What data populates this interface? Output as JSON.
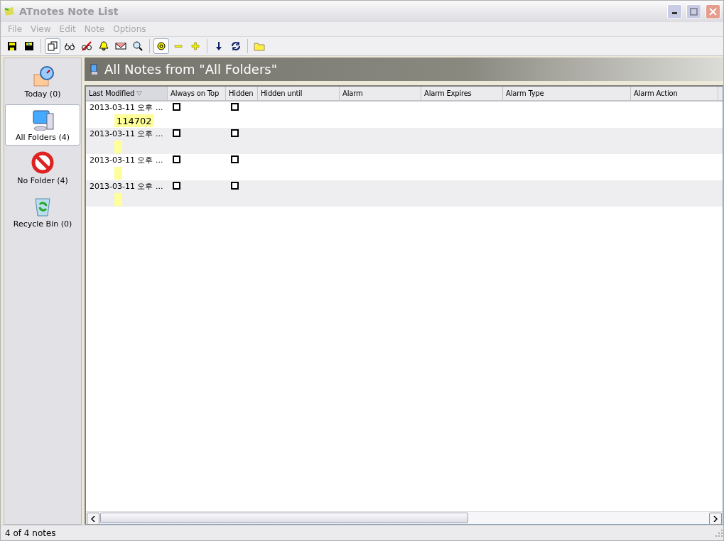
{
  "window": {
    "title": "ATnotes Note List"
  },
  "menu": [
    {
      "label": "File"
    },
    {
      "label": "View"
    },
    {
      "label": "Edit"
    },
    {
      "label": "Note"
    },
    {
      "label": "Options"
    }
  ],
  "toolbar": [
    [
      {
        "kind": "save",
        "pressed": false
      },
      {
        "kind": "saveas",
        "pressed": false
      }
    ],
    [
      {
        "kind": "copy",
        "pressed": true
      },
      {
        "kind": "glasses",
        "pressed": false
      },
      {
        "kind": "noglasses",
        "pressed": false
      },
      {
        "kind": "bell",
        "pressed": false
      },
      {
        "kind": "envelope",
        "pressed": false
      },
      {
        "kind": "search",
        "pressed": false
      }
    ],
    [
      {
        "kind": "target",
        "pressed": true
      },
      {
        "kind": "minus",
        "pressed": false
      },
      {
        "kind": "plus",
        "pressed": false
      }
    ],
    [
      {
        "kind": "down",
        "pressed": false
      },
      {
        "kind": "refresh",
        "pressed": false
      }
    ],
    [
      {
        "kind": "folder",
        "pressed": false
      }
    ]
  ],
  "sidebar": {
    "items": [
      {
        "kind": "today",
        "label": "Today (0)",
        "selected": false
      },
      {
        "kind": "computer",
        "label": "All Folders (4)",
        "selected": true
      },
      {
        "kind": "nofolder",
        "label": "No Folder (4)",
        "selected": false
      },
      {
        "kind": "recycle",
        "label": "Recycle Bin (0)",
        "selected": false
      }
    ]
  },
  "header": {
    "title": "All Notes from \"All Folders\""
  },
  "table": {
    "columns": [
      {
        "label": "Last Modified",
        "sorted": true
      },
      {
        "label": "Always on Top",
        "sorted": false
      },
      {
        "label": "Hidden",
        "sorted": false
      },
      {
        "label": "Hidden until",
        "sorted": false
      },
      {
        "label": "Alarm",
        "sorted": false
      },
      {
        "label": "Alarm Expires",
        "sorted": false
      },
      {
        "label": "Alarm Type",
        "sorted": false
      },
      {
        "label": "Alarm Action",
        "sorted": false
      }
    ],
    "rows": [
      {
        "modified": "2013-03-11 오후 ...",
        "always_on_top": false,
        "hidden": false,
        "note": "114702",
        "color": "#ffff99"
      },
      {
        "modified": "2013-03-11 오후 ...",
        "always_on_top": false,
        "hidden": false,
        "color": "#ffff99"
      },
      {
        "modified": "2013-03-11 오후 ...",
        "always_on_top": false,
        "hidden": false,
        "color": "#ffff99"
      },
      {
        "modified": "2013-03-11 오후 ...",
        "always_on_top": false,
        "hidden": false,
        "color": "#ffff99"
      }
    ]
  },
  "status_bar": {
    "text": "4 of 4 notes"
  }
}
